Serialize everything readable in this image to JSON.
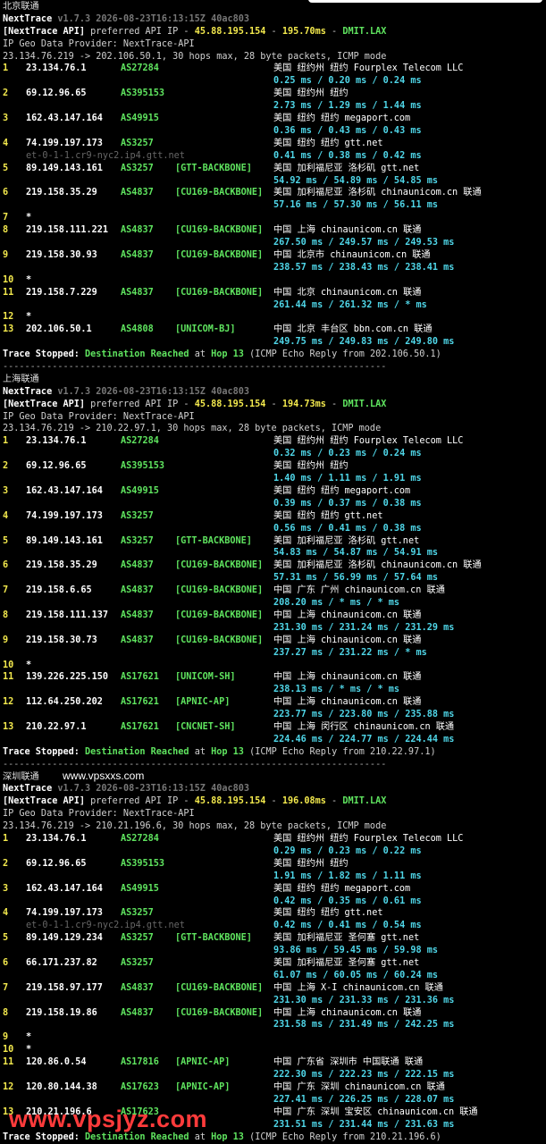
{
  "sections": [
    {
      "location": "北京联通",
      "version": "v1.7.3 2026-08-23T16:13:15Z 40ac803",
      "api_ip": "45.88.195.154",
      "api_ms": "195.70ms",
      "api_suffix": "DMIT.LAX",
      "provider": "IP Geo Data Provider: NextTrace-API",
      "cmd": "23.134.76.219 -> 202.106.50.1, 30 hops max, 28 byte packets, ICMP mode",
      "hops": [
        {
          "n": "1",
          "ip": "23.134.76.1",
          "asn": "AS27284",
          "tag": "",
          "geo": "美国 纽约州 纽约  Fourplex Telecom LLC",
          "rtt": "0.25 ms / 0.20 ms / 0.24 ms",
          "ptr": ""
        },
        {
          "n": "2",
          "ip": "69.12.96.65",
          "asn": "AS395153",
          "tag": "",
          "geo": "美国 纽约州 纽约",
          "rtt": "2.73 ms / 1.29 ms / 1.44 ms",
          "ptr": ""
        },
        {
          "n": "3",
          "ip": "162.43.147.164",
          "asn": "AS49915",
          "tag": "",
          "geo": "美国 纽约 纽约  megaport.com",
          "rtt": "0.36 ms / 0.43 ms / 0.43 ms",
          "ptr": ""
        },
        {
          "n": "4",
          "ip": "74.199.197.173",
          "asn": "AS3257",
          "tag": "",
          "geo": "美国 纽约 纽约  gtt.net",
          "rtt": "0.41 ms / 0.38 ms / 0.42 ms",
          "ptr": "et-0-1-1.cr9-nyc2.ip4.gtt.net"
        },
        {
          "n": "5",
          "ip": "89.149.143.161",
          "asn": "AS3257",
          "tag": "[GTT-BACKBONE]",
          "geo": "美国 加利福尼亚 洛杉矶  gtt.net",
          "rtt": "54.92 ms / 54.89 ms / 54.85 ms",
          "ptr": ""
        },
        {
          "n": "6",
          "ip": "219.158.35.29",
          "asn": "AS4837",
          "tag": "[CU169-BACKBONE]",
          "geo": "美国 加利福尼亚 洛杉矶  chinaunicom.cn  联通",
          "rtt": "57.16 ms / 57.30 ms / 56.11 ms",
          "ptr": ""
        },
        {
          "n": "7",
          "ip": "*",
          "asn": "",
          "tag": "",
          "geo": "",
          "rtt": "",
          "ptr": ""
        },
        {
          "n": "8",
          "ip": "219.158.111.221",
          "asn": "AS4837",
          "tag": "[CU169-BACKBONE]",
          "geo": "中国 上海   chinaunicom.cn  联通",
          "rtt": "267.50 ms / 249.57 ms / 249.53 ms",
          "ptr": ""
        },
        {
          "n": "9",
          "ip": "219.158.30.93",
          "asn": "AS4837",
          "tag": "[CU169-BACKBONE]",
          "geo": "中国 北京市  chinaunicom.cn  联通",
          "rtt": "238.57 ms / 238.43 ms / 238.41 ms",
          "ptr": ""
        },
        {
          "n": "10",
          "ip": "*",
          "asn": "",
          "tag": "",
          "geo": "",
          "rtt": "",
          "ptr": ""
        },
        {
          "n": "11",
          "ip": "219.158.7.229",
          "asn": "AS4837",
          "tag": "[CU169-BACKBONE]",
          "geo": "中国 北京   chinaunicom.cn  联通",
          "rtt": "261.44 ms / 261.32 ms / * ms",
          "ptr": ""
        },
        {
          "n": "12",
          "ip": "*",
          "asn": "",
          "tag": "",
          "geo": "",
          "rtt": "",
          "ptr": ""
        },
        {
          "n": "13",
          "ip": "202.106.50.1",
          "asn": "AS4808",
          "tag": "[UNICOM-BJ]",
          "geo": "中国 北京  丰台区  bbn.com.cn  联通",
          "rtt": "249.75 ms / 249.83 ms / 249.80 ms",
          "ptr": ""
        }
      ],
      "stop_dest": "Destination Reached",
      "stop_hop": "Hop 13",
      "stop_tail": "(ICMP Echo Reply from 202.106.50.1)"
    },
    {
      "location": "上海联通",
      "version": "v1.7.3 2026-08-23T16:13:15Z 40ac803",
      "api_ip": "45.88.195.154",
      "api_ms": "194.73ms",
      "api_suffix": "DMIT.LAX",
      "provider": "IP Geo Data Provider: NextTrace-API",
      "cmd": "23.134.76.219 -> 210.22.97.1, 30 hops max, 28 byte packets, ICMP mode",
      "hops": [
        {
          "n": "1",
          "ip": "23.134.76.1",
          "asn": "AS27284",
          "tag": "",
          "geo": "美国 纽约州 纽约  Fourplex Telecom LLC",
          "rtt": "0.32 ms / 0.23 ms / 0.24 ms",
          "ptr": ""
        },
        {
          "n": "2",
          "ip": "69.12.96.65",
          "asn": "AS395153",
          "tag": "",
          "geo": "美国 纽约州 纽约",
          "rtt": "1.40 ms / 1.11 ms / 1.91 ms",
          "ptr": ""
        },
        {
          "n": "3",
          "ip": "162.43.147.164",
          "asn": "AS49915",
          "tag": "",
          "geo": "美国 纽约 纽约  megaport.com",
          "rtt": "0.39 ms / 0.37 ms / 0.38 ms",
          "ptr": ""
        },
        {
          "n": "4",
          "ip": "74.199.197.173",
          "asn": "AS3257",
          "tag": "",
          "geo": "美国 纽约 纽约  gtt.net",
          "rtt": "0.56 ms / 0.41 ms / 0.38 ms",
          "ptr": ""
        },
        {
          "n": "5",
          "ip": "89.149.143.161",
          "asn": "AS3257",
          "tag": "[GTT-BACKBONE]",
          "geo": "美国 加利福尼亚 洛杉矶  gtt.net",
          "rtt": "54.83 ms / 54.87 ms / 54.91 ms",
          "ptr": ""
        },
        {
          "n": "6",
          "ip": "219.158.35.29",
          "asn": "AS4837",
          "tag": "[CU169-BACKBONE]",
          "geo": "美国 加利福尼亚 洛杉矶  chinaunicom.cn  联通",
          "rtt": "57.31 ms / 56.99 ms / 57.64 ms",
          "ptr": ""
        },
        {
          "n": "7",
          "ip": "219.158.6.65",
          "asn": "AS4837",
          "tag": "[CU169-BACKBONE]",
          "geo": "中国 广东 广州  chinaunicom.cn  联通",
          "rtt": "208.20 ms / * ms / * ms",
          "ptr": ""
        },
        {
          "n": "8",
          "ip": "219.158.111.137",
          "asn": "AS4837",
          "tag": "[CU169-BACKBONE]",
          "geo": "中国 上海   chinaunicom.cn  联通",
          "rtt": "231.30 ms / 231.24 ms / 231.29 ms",
          "ptr": ""
        },
        {
          "n": "9",
          "ip": "219.158.30.73",
          "asn": "AS4837",
          "tag": "[CU169-BACKBONE]",
          "geo": "中国 上海   chinaunicom.cn  联通",
          "rtt": "237.27 ms / 231.22 ms / * ms",
          "ptr": ""
        },
        {
          "n": "10",
          "ip": "*",
          "asn": "",
          "tag": "",
          "geo": "",
          "rtt": "",
          "ptr": ""
        },
        {
          "n": "11",
          "ip": "139.226.225.150",
          "asn": "AS17621",
          "tag": "[UNICOM-SH]",
          "geo": "中国 上海   chinaunicom.cn  联通",
          "rtt": "238.13 ms / * ms / * ms",
          "ptr": ""
        },
        {
          "n": "12",
          "ip": "112.64.250.202",
          "asn": "AS17621",
          "tag": "[APNIC-AP]",
          "geo": "中国 上海   chinaunicom.cn  联通",
          "rtt": "223.77 ms / 223.80 ms / 235.88 ms",
          "ptr": ""
        },
        {
          "n": "13",
          "ip": "210.22.97.1",
          "asn": "AS17621",
          "tag": "[CNCNET-SH]",
          "geo": "中国 上海  闵行区 chinaunicom.cn  联通",
          "rtt": "224.46 ms / 224.77 ms / 224.44 ms",
          "ptr": ""
        }
      ],
      "stop_dest": "Destination Reached",
      "stop_hop": "Hop 13",
      "stop_tail": "(ICMP Echo Reply from 210.22.97.1)"
    },
    {
      "location": "深圳联通",
      "version": "v1.7.3 2026-08-23T16:13:15Z 40ac803",
      "api_ip": "45.88.195.154",
      "api_ms": "196.08ms",
      "api_suffix": "DMIT.LAX",
      "provider": "IP Geo Data Provider: NextTrace-API",
      "cmd": "23.134.76.219 -> 210.21.196.6, 30 hops max, 28 byte packets, ICMP mode",
      "hops": [
        {
          "n": "1",
          "ip": "23.134.76.1",
          "asn": "AS27284",
          "tag": "",
          "geo": "美国 纽约州 纽约  Fourplex Telecom LLC",
          "rtt": "0.29 ms / 0.23 ms / 0.22 ms",
          "ptr": ""
        },
        {
          "n": "2",
          "ip": "69.12.96.65",
          "asn": "AS395153",
          "tag": "",
          "geo": "美国 纽约州 纽约",
          "rtt": "1.91 ms / 1.82 ms / 1.11 ms",
          "ptr": ""
        },
        {
          "n": "3",
          "ip": "162.43.147.164",
          "asn": "AS49915",
          "tag": "",
          "geo": "美国 纽约 纽约  megaport.com",
          "rtt": "0.42 ms / 0.35 ms / 0.61 ms",
          "ptr": ""
        },
        {
          "n": "4",
          "ip": "74.199.197.173",
          "asn": "AS3257",
          "tag": "",
          "geo": "美国 纽约 纽约  gtt.net",
          "rtt": "0.42 ms / 0.41 ms / 0.54 ms",
          "ptr": "et-0-1-1.cr9-nyc2.ip4.gtt.net"
        },
        {
          "n": "5",
          "ip": "89.149.129.234",
          "asn": "AS3257",
          "tag": "[GTT-BACKBONE]",
          "geo": "美国 加利福尼亚 圣何塞  gtt.net",
          "rtt": "93.86 ms / 59.45 ms / 59.98 ms",
          "ptr": ""
        },
        {
          "n": "6",
          "ip": "66.171.237.82",
          "asn": "AS3257",
          "tag": "",
          "geo": "美国 加利福尼亚 圣何塞  gtt.net",
          "rtt": "61.07 ms / 60.05 ms / 60.24 ms",
          "ptr": ""
        },
        {
          "n": "7",
          "ip": "219.158.97.177",
          "asn": "AS4837",
          "tag": "[CU169-BACKBONE]",
          "geo": "中国 上海  X-I chinaunicom.cn  联通",
          "rtt": "231.30 ms / 231.33 ms / 231.36 ms",
          "ptr": ""
        },
        {
          "n": "8",
          "ip": "219.158.19.86",
          "asn": "AS4837",
          "tag": "[CU169-BACKBONE]",
          "geo": "中国 上海   chinaunicom.cn  联通",
          "rtt": "231.58 ms / 231.49 ms / 242.25 ms",
          "ptr": ""
        },
        {
          "n": "9",
          "ip": "*",
          "asn": "",
          "tag": "",
          "geo": "",
          "rtt": "",
          "ptr": ""
        },
        {
          "n": "10",
          "ip": "*",
          "asn": "",
          "tag": "",
          "geo": "",
          "rtt": "",
          "ptr": ""
        },
        {
          "n": "11",
          "ip": "120.86.0.54",
          "asn": "AS17816",
          "tag": "[APNIC-AP]",
          "geo": "中国 广东省 深圳市  中国联通  联通",
          "rtt": "222.30 ms / 222.23 ms / 222.15 ms",
          "ptr": ""
        },
        {
          "n": "12",
          "ip": "120.80.144.38",
          "asn": "AS17623",
          "tag": "[APNIC-AP]",
          "geo": "中国 广东 深圳  chinaunicom.cn  联通",
          "rtt": "227.41 ms / 226.25 ms / 228.07 ms",
          "ptr": ""
        },
        {
          "n": "13",
          "ip": "210.21.196.6",
          "asn": "AS17623",
          "tag": "",
          "geo": "中国 广东 深圳 宝安区 chinaunicom.cn  联通",
          "rtt": "231.51 ms / 231.44 ms / 231.63 ms",
          "ptr": ""
        }
      ],
      "stop_dest": "Destination Reached",
      "stop_hop": "Hop 13",
      "stop_tail": "(ICMP Echo Reply from 210.21.196.6)"
    }
  ],
  "separator": "----------------------------------------------------------------------",
  "labels": {
    "app": "NextTrace",
    "api_prefix": "[NextTrace API]",
    "api_mid": " preferred API IP - ",
    "trace_stopped": "Trace Stopped:",
    "at": " at "
  },
  "watermarks": {
    "small": "www.vpsxxs.com",
    "large": "www.vpsjyz.com"
  },
  "colors": {
    "background": "#000000",
    "hop_number": "#f3e94d",
    "asn": "#5fe45f",
    "rtt": "#4fd6e8",
    "watermark_red": "#ff3b3b"
  }
}
